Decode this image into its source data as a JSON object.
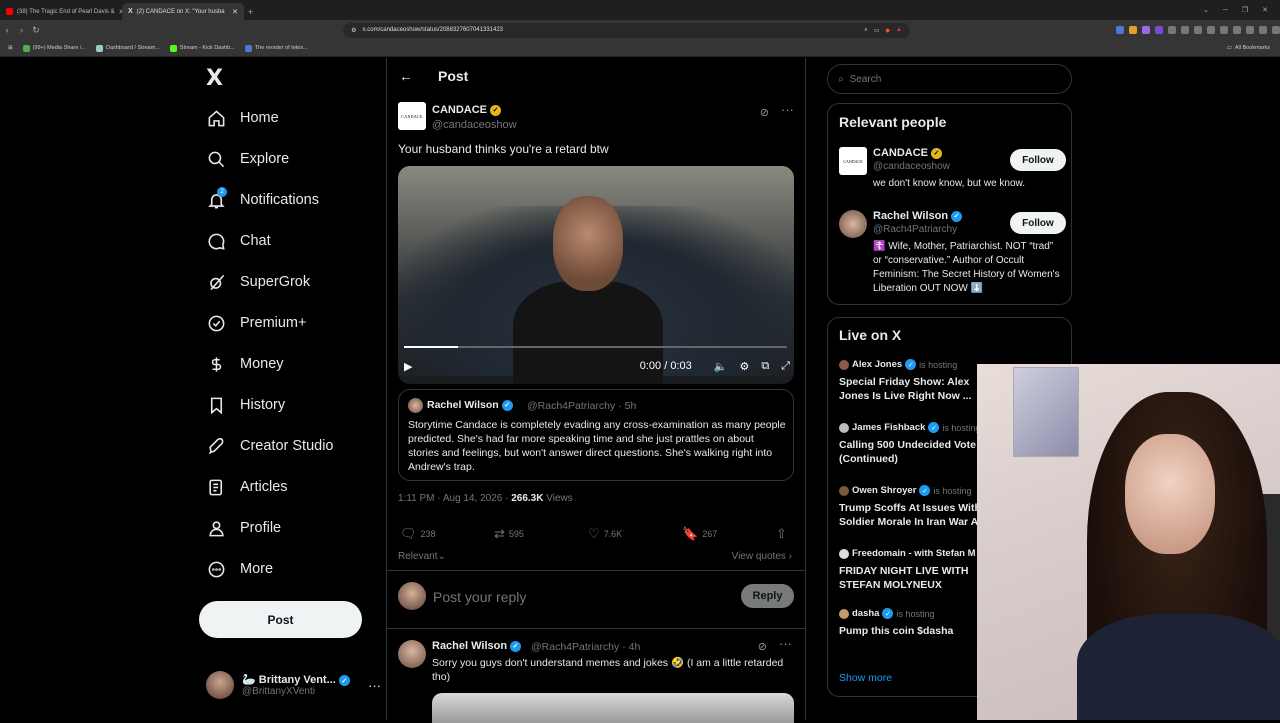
{
  "browser": {
    "tabs": [
      {
        "title": "(38) The Tragic End of Pearl Davis &",
        "active": false,
        "favicon_color": "#ff0000"
      },
      {
        "title": "(2) CANDACE on X: \"Your husba",
        "active": true,
        "favicon_color": "#ffffff"
      }
    ],
    "url": "x.com/candaceoshow/status/2088327607041331423",
    "bookmarks": [
      {
        "label": "(99+) Media Share /...",
        "color": "#4caf50"
      },
      {
        "label": "Dashboard / Stream...",
        "color": "#9cc"
      },
      {
        "label": "Stream - Kick Dashb...",
        "color": "#53fc18"
      },
      {
        "label": "The reorder of tetes...",
        "color": "#4a7bd4"
      }
    ],
    "all_bookmarks": "All Bookmarks"
  },
  "nav": {
    "logo": "X",
    "items": [
      {
        "label": "Home",
        "icon": "home-icon"
      },
      {
        "label": "Explore",
        "icon": "search-icon"
      },
      {
        "label": "Notifications",
        "icon": "bell-icon",
        "badge": "2"
      },
      {
        "label": "Chat",
        "icon": "chat-icon"
      },
      {
        "label": "SuperGrok",
        "icon": "grok-icon"
      },
      {
        "label": "Premium+",
        "icon": "premium-icon"
      },
      {
        "label": "Money",
        "icon": "money-icon"
      },
      {
        "label": "History",
        "icon": "bookmark-icon"
      },
      {
        "label": "Creator Studio",
        "icon": "rocket-icon"
      },
      {
        "label": "Articles",
        "icon": "article-icon"
      },
      {
        "label": "Profile",
        "icon": "profile-icon"
      },
      {
        "label": "More",
        "icon": "more-icon"
      }
    ],
    "post_button": "Post",
    "account": {
      "name": "🦢 Brittany Vent...",
      "handle": "@BrittanyXVenti"
    }
  },
  "main": {
    "header_title": "Post",
    "author": {
      "name": "CANDACE",
      "handle": "@candaceoshow",
      "avatar_text": "CANDACE"
    },
    "text": "Your husband thinks you're a retard btw",
    "video": {
      "time": "0:00 / 0:03",
      "progress": 0.14
    },
    "quote": {
      "name": "Rachel Wilson",
      "handle": "@Rach4Patriarchy · 5h",
      "text": "Storytime Candace is completely evading any cross-examination as many people predicted. She's had far more speaking time and she just prattles on about stories and feelings, but won't answer direct questions. She's walking right into Andrew's trap."
    },
    "meta": {
      "time": "1:11 PM · Aug 14, 2026 · ",
      "views_count": "266.3K",
      "views_label": " Views"
    },
    "stats": {
      "replies": "238",
      "reposts": "595",
      "likes": "7.6K",
      "bookmarks": "267"
    },
    "relevant": "Relevant",
    "view_quotes": "View quotes",
    "reply_placeholder": "Post your reply",
    "reply_button": "Reply",
    "reply_post": {
      "name": "Rachel Wilson",
      "handle": "@Rach4Patriarchy · 4h",
      "text": "Sorry you guys don't understand memes and jokes 🤣 (I am a little retarded tho)"
    }
  },
  "right": {
    "search_placeholder": "Search",
    "relevant_title": "Relevant people",
    "people": [
      {
        "name": "CANDACE",
        "handle": "@candaceoshow",
        "bio": "we don't know know, but we know.",
        "follow": "Follow"
      },
      {
        "name": "Rachel Wilson",
        "handle": "@Rach4Patriarchy",
        "bio": "☦️ Wife, Mother, Patriarchist. NOT “trad” or “conservative.” Author of Occult Feminism: The Secret History of Women's Liberation OUT NOW ⬇️",
        "follow": "Follow"
      }
    ],
    "live_title": "Live on X",
    "live": [
      {
        "host": "Alex Jones",
        "status": "is hosting",
        "title": "Special Friday Show: Alex",
        "title2": "Jones Is Live Right Now ..."
      },
      {
        "host": "James Fishback",
        "status": "is hosting",
        "title": "Calling 500 Undecided Vote",
        "title2": "(Continued)"
      },
      {
        "host": "Owen Shroyer",
        "status": "is hosting",
        "title": "Trump Scoffs At Issues With",
        "title2": "Soldier Morale In Iran War A"
      },
      {
        "host": "Freedomain - with Stefan M",
        "status": "",
        "title": "FRIDAY NIGHT LIVE WITH",
        "title2": "STEFAN MOLYNEUX"
      },
      {
        "host": "dasha",
        "status": "is hosting",
        "title": "Pump this coin $dasha",
        "title2": ""
      }
    ],
    "show_more": "Show more"
  }
}
